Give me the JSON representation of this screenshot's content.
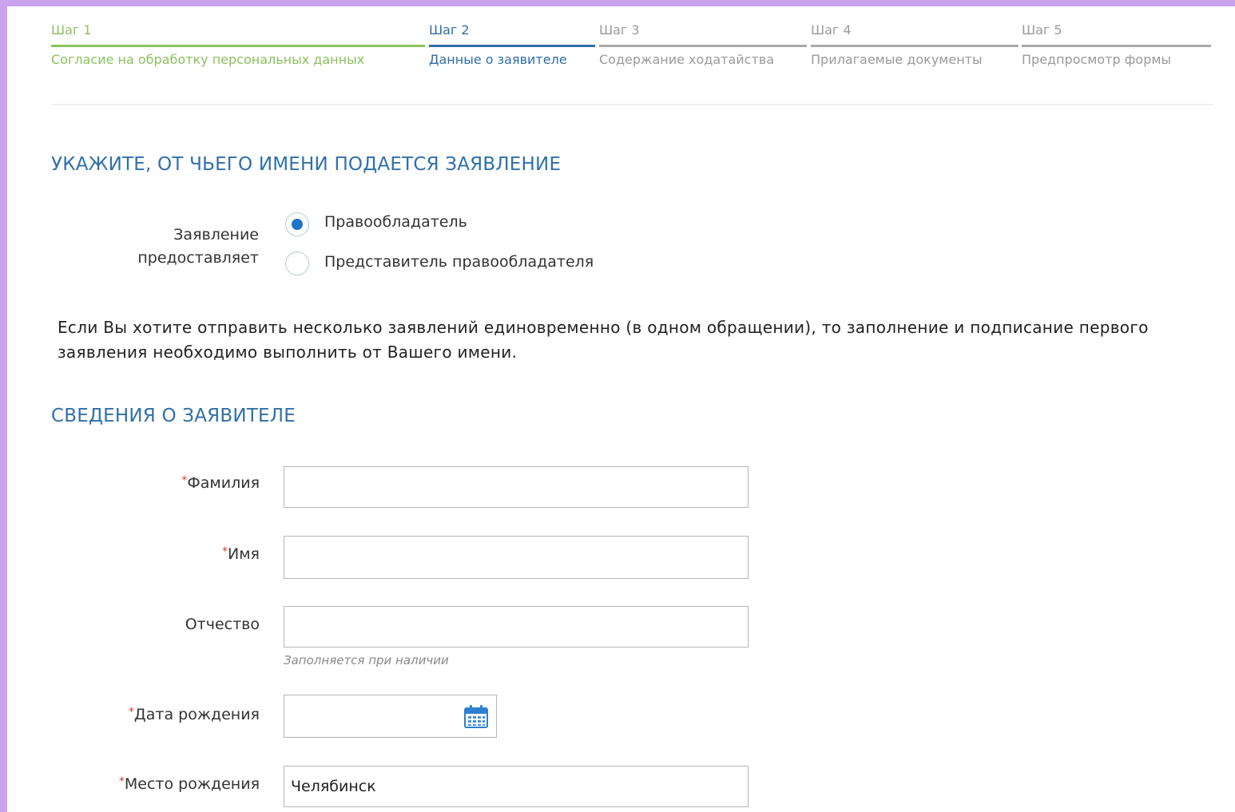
{
  "steps": [
    {
      "num": "Шаг 1",
      "title": "Согласие на обработку персональных данных",
      "state": "done"
    },
    {
      "num": "Шаг 2",
      "title": "Данные о заявителе",
      "state": "active"
    },
    {
      "num": "Шаг 3",
      "title": "Содержание ходатайства",
      "state": "pending"
    },
    {
      "num": "Шаг 4",
      "title": "Прилагаемые документы",
      "state": "pending"
    },
    {
      "num": "Шаг 5",
      "title": "Предпросмотр формы",
      "state": "pending"
    }
  ],
  "applicant_type": {
    "section_title": "УКАЖИТЕ, ОТ ЧЬЕГО ИМЕНИ ПОДАЕТСЯ ЗАЯВЛЕНИЕ",
    "label_line1": "Заявление",
    "label_line2": "предоставляет",
    "options": [
      {
        "label": "Правообладатель",
        "checked": true
      },
      {
        "label": "Представитель правообладателя",
        "checked": false
      }
    ],
    "info_text": "Если Вы хотите отправить несколько заявлений единовременно (в одном обращении), то заполнение и подписание первого заявления необходимо выполнить от Вашего имени."
  },
  "applicant_info": {
    "section_title": "СВЕДЕНИЯ О ЗАЯВИТЕЛЕ",
    "required_mark": "*",
    "fields": {
      "surname": {
        "label": "Фамилия",
        "value": ""
      },
      "name": {
        "label": "Имя",
        "value": ""
      },
      "patronymic": {
        "label": "Отчество",
        "value": "",
        "hint": "Заполняется при наличии"
      },
      "birth_date": {
        "label": "Дата рождения",
        "value": ""
      },
      "birth_place": {
        "label": "Место рождения",
        "value": "Челябинск"
      }
    }
  },
  "colors": {
    "done": "#8cc15f",
    "active": "#2f6ea8",
    "pending": "#a8a8a8",
    "section_title": "#2f6fab",
    "radio_checked": "#1f73c9",
    "required": "#d23a3a",
    "outer_background": "#c9a3ee"
  }
}
